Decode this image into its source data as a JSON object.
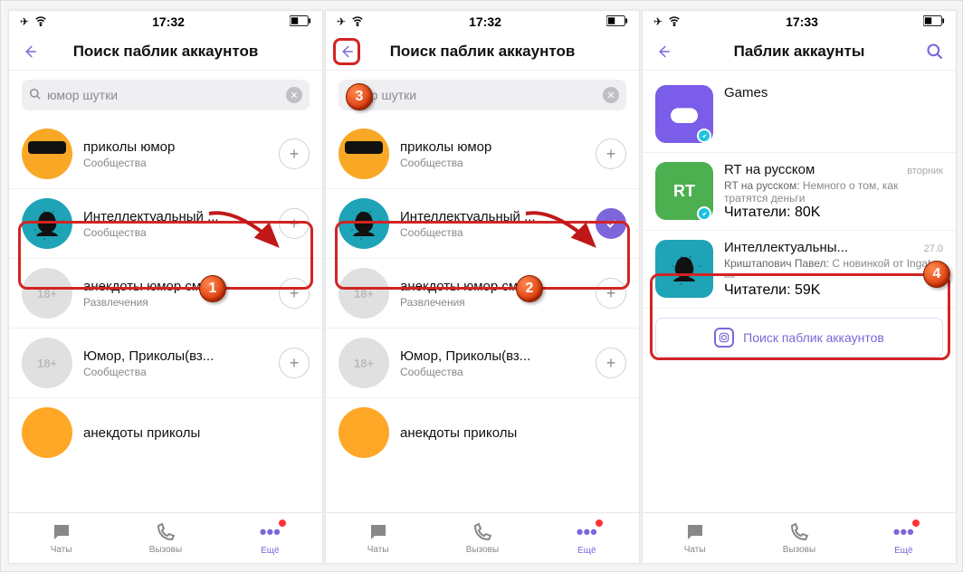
{
  "status": {
    "time1": "17:32",
    "time2": "17:32",
    "time3": "17:33"
  },
  "titles": {
    "search": "Поиск паблик аккаунтов",
    "publics": "Паблик аккаунты"
  },
  "search": {
    "query": "юмор шутки",
    "query_obscured": "ор шутки"
  },
  "rows": {
    "r1": {
      "title": "приколы юмор",
      "sub": "Сообщества"
    },
    "r2": {
      "title": "Интеллектуальный ...",
      "sub": "Сообщества"
    },
    "r3": {
      "title": "анекдоты юмор см...",
      "sub": "Развлечения"
    },
    "r4": {
      "title": "Юмор, Приколы(вз...",
      "sub": "Сообщества"
    },
    "r5": {
      "title": "анекдоты приколы"
    }
  },
  "publics": {
    "games": {
      "title": "Games"
    },
    "rt": {
      "title": "RT на русском",
      "when": "вторник",
      "prefix": "RT на русском:",
      "msg": " Немного о том, как тратятся деньги",
      "readers": "Читатели: 80K"
    },
    "int": {
      "title": "Интеллектуальны...",
      "when": "27.0",
      "prefix": "Криштапович Павел:",
      "msg": " С новинкой от Ingate —",
      "readers": "Читатели: 59K"
    },
    "searchbtn": "Поиск паблик аккаунтов"
  },
  "tabs": {
    "chats": "Чаты",
    "calls": "Вызовы",
    "more": "Ещё"
  },
  "markers": {
    "m1": "1",
    "m2": "2",
    "m3": "3",
    "m4": "4"
  }
}
